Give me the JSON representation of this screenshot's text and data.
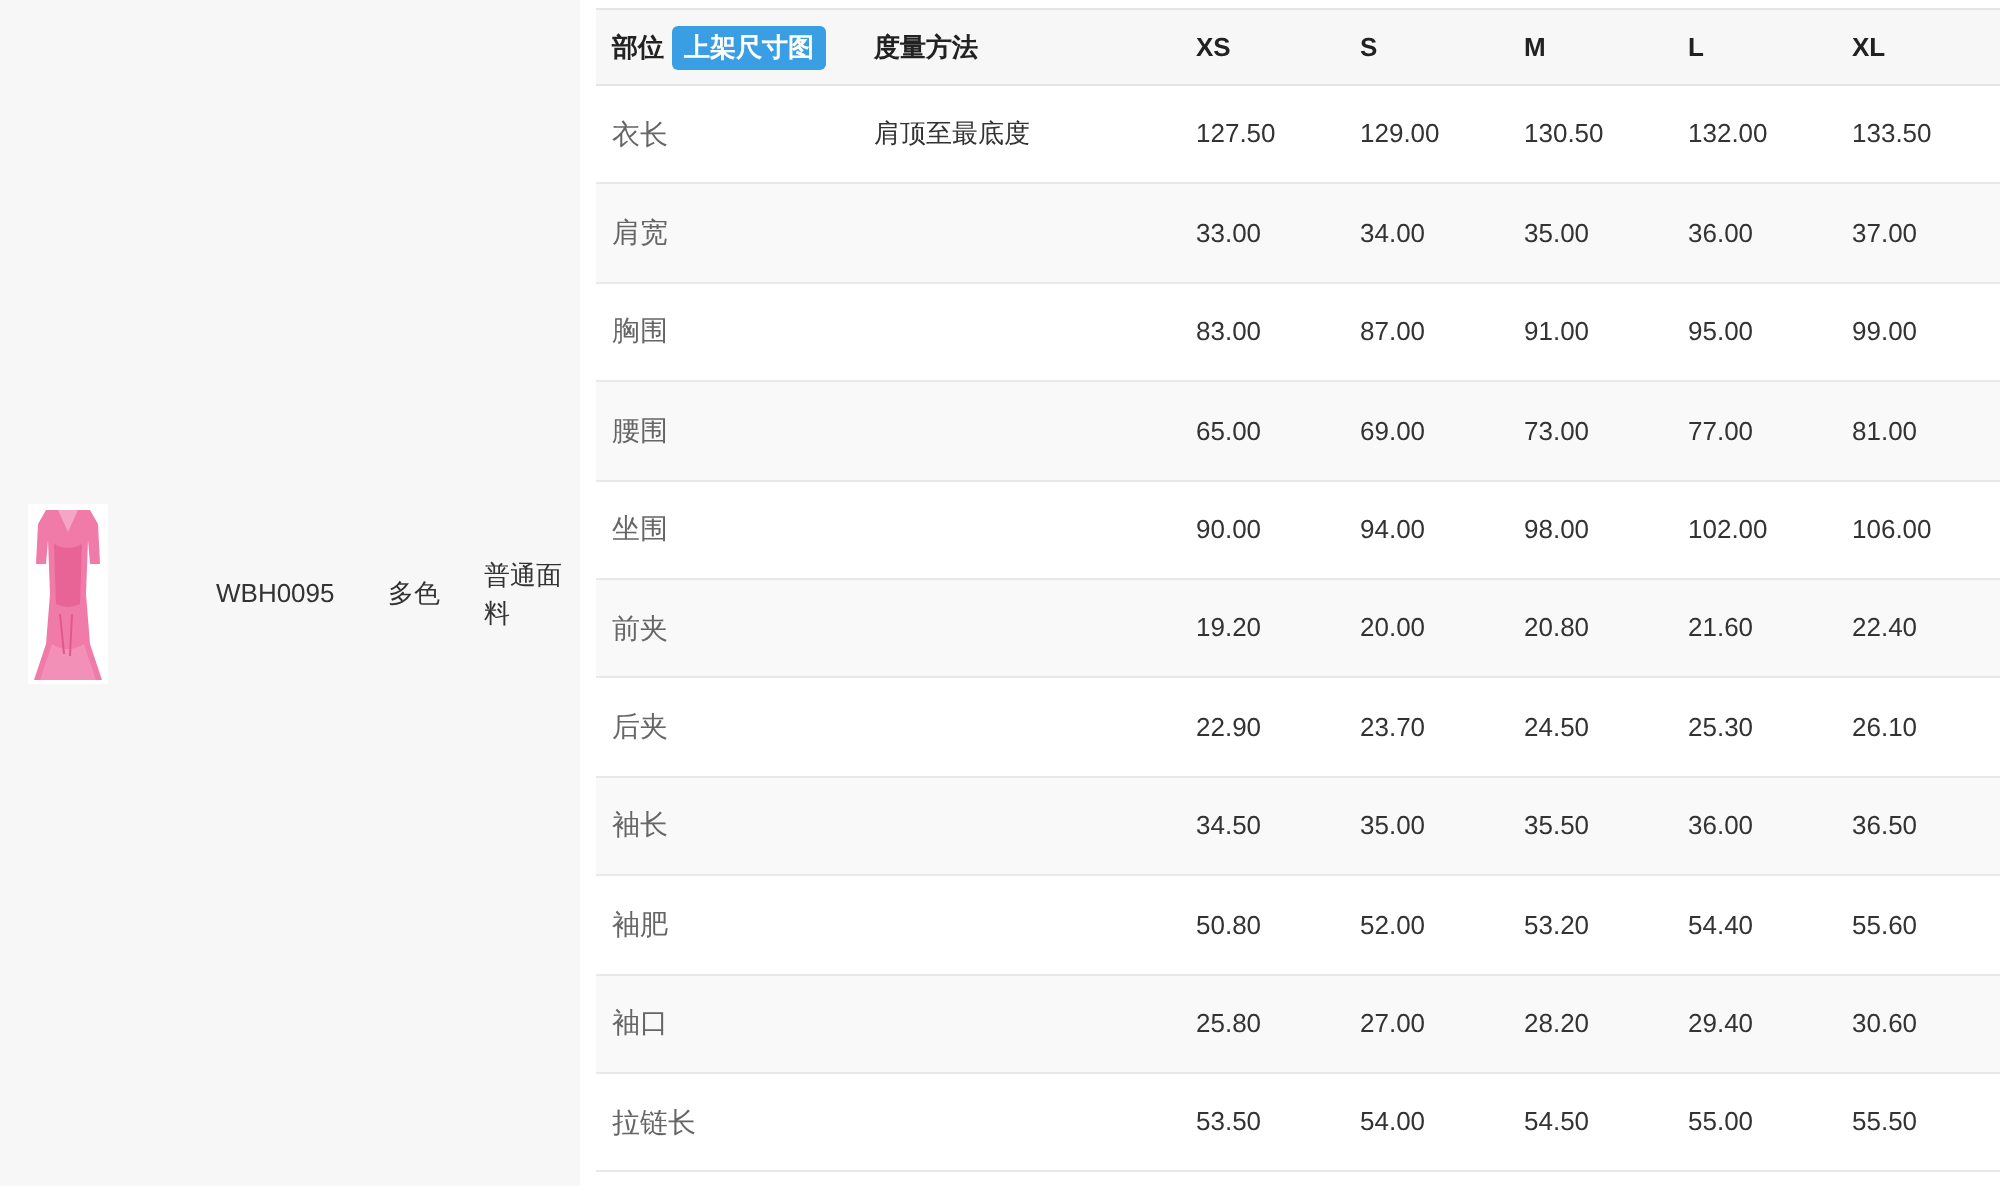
{
  "product": {
    "code": "WBH0095",
    "color_option": "多色",
    "fabric": "普通面料"
  },
  "table": {
    "columns": [
      "部位",
      "度量方法",
      "XS",
      "S",
      "M",
      "L",
      "XL"
    ],
    "header_button": "上架尺寸图",
    "rows": [
      {
        "part": "衣长",
        "method": "肩顶至最底度",
        "values": [
          "127.50",
          "129.00",
          "130.50",
          "132.00",
          "133.50"
        ]
      },
      {
        "part": "肩宽",
        "values": [
          "33.00",
          "34.00",
          "35.00",
          "36.00",
          "37.00"
        ]
      },
      {
        "part": "胸围",
        "values": [
          "83.00",
          "87.00",
          "91.00",
          "95.00",
          "99.00"
        ]
      },
      {
        "part": "腰围",
        "values": [
          "65.00",
          "69.00",
          "73.00",
          "77.00",
          "81.00"
        ]
      },
      {
        "part": "坐围",
        "values": [
          "90.00",
          "94.00",
          "98.00",
          "102.00",
          "106.00"
        ]
      },
      {
        "part": "前夹",
        "values": [
          "19.20",
          "20.00",
          "20.80",
          "21.60",
          "22.40"
        ]
      },
      {
        "part": "后夹",
        "values": [
          "22.90",
          "23.70",
          "24.50",
          "25.30",
          "26.10"
        ]
      },
      {
        "part": "袖长",
        "values": [
          "34.50",
          "35.00",
          "35.50",
          "36.00",
          "36.50"
        ]
      },
      {
        "part": "袖肥",
        "values": [
          "50.80",
          "52.00",
          "53.20",
          "54.40",
          "55.60"
        ]
      },
      {
        "part": "袖口",
        "values": [
          "25.80",
          "27.00",
          "28.20",
          "29.40",
          "30.60"
        ]
      },
      {
        "part": "拉链长",
        "values": [
          "53.50",
          "54.00",
          "54.50",
          "55.00",
          "55.50"
        ]
      }
    ]
  }
}
